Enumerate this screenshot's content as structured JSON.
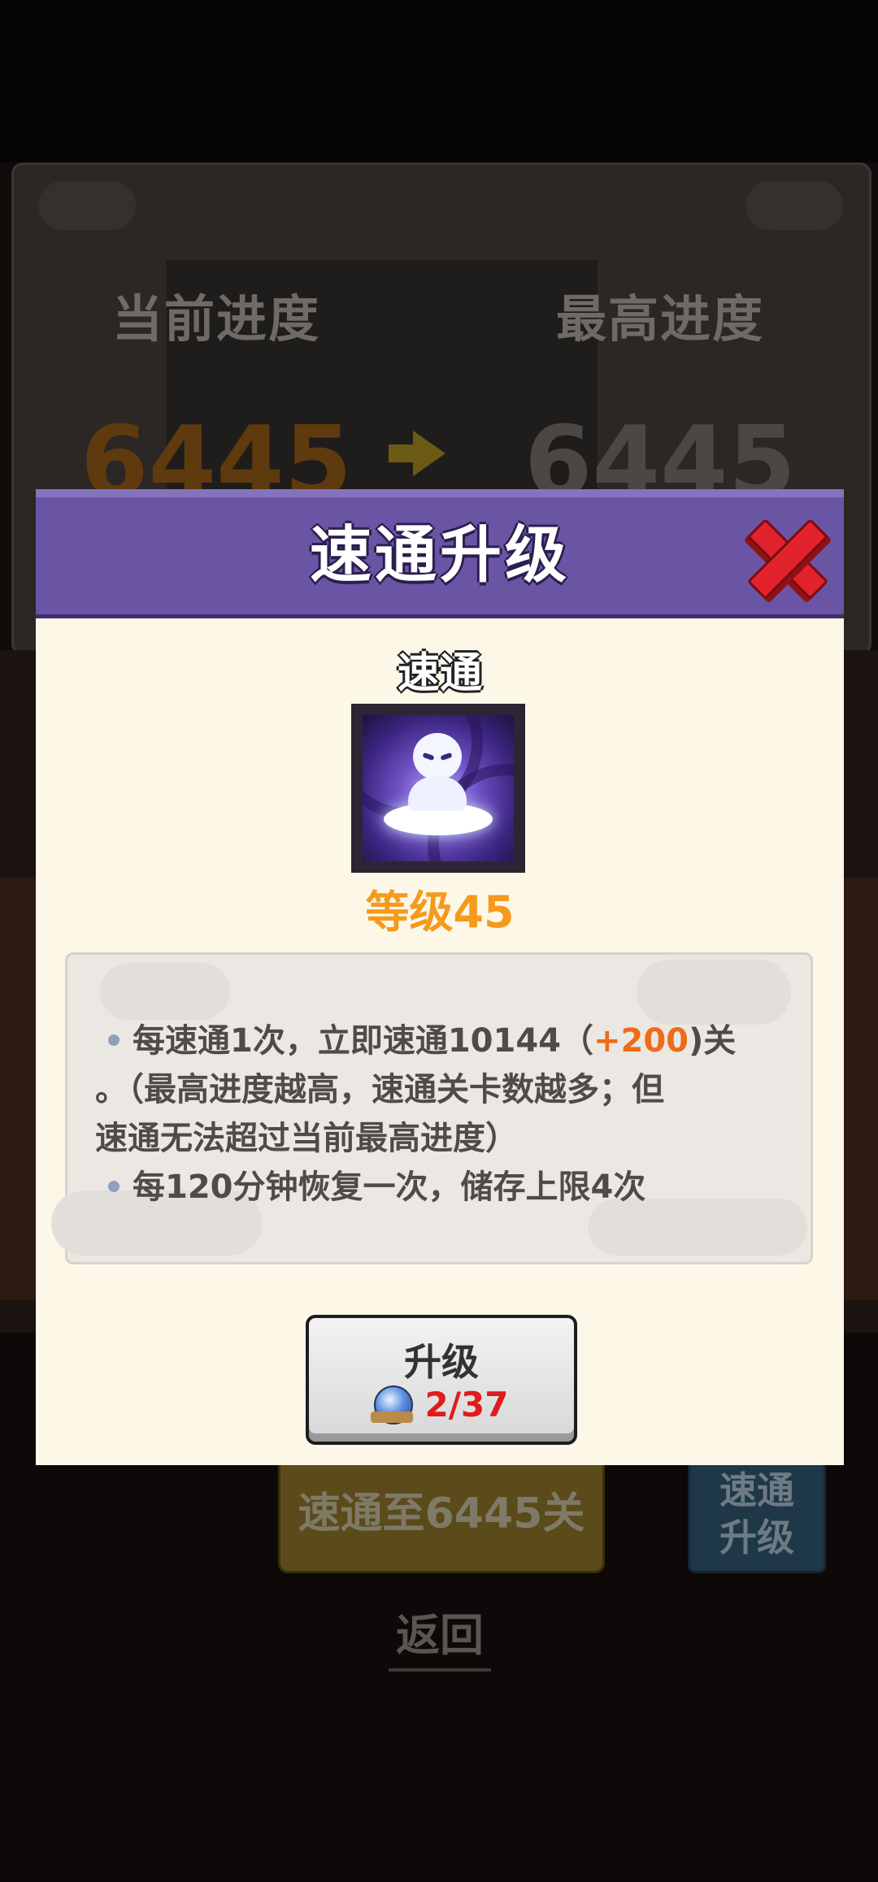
{
  "background": {
    "current_progress_label": "当前进度",
    "max_progress_label": "最高进度",
    "current_progress_value": "6445",
    "max_progress_value": "6445",
    "skip_button_label": "速通至6445关",
    "side_button_line1": "速通",
    "side_button_line2": "升级",
    "back_label": "返回"
  },
  "modal": {
    "title": "速通升级",
    "skill_name": "速通",
    "level_text": "等级45",
    "description": {
      "line1_prefix": "每速通1次，立即速通10144（",
      "line1_bonus": "+200",
      "line1_suffix": ")关",
      "line2": "。（最高进度越高，速通关卡数越多；但",
      "line3": "速通无法超过当前最高进度）",
      "line4": "每120分钟恢复一次，储存上限4次"
    },
    "upgrade_button": {
      "label": "升级",
      "cost": "2/37"
    }
  },
  "colors": {
    "header_purple": "#6a55a4",
    "level_orange": "#f59a1c",
    "bonus_orange": "#ee6b1a",
    "cost_red": "#e01b1b",
    "close_red": "#e3232c"
  }
}
